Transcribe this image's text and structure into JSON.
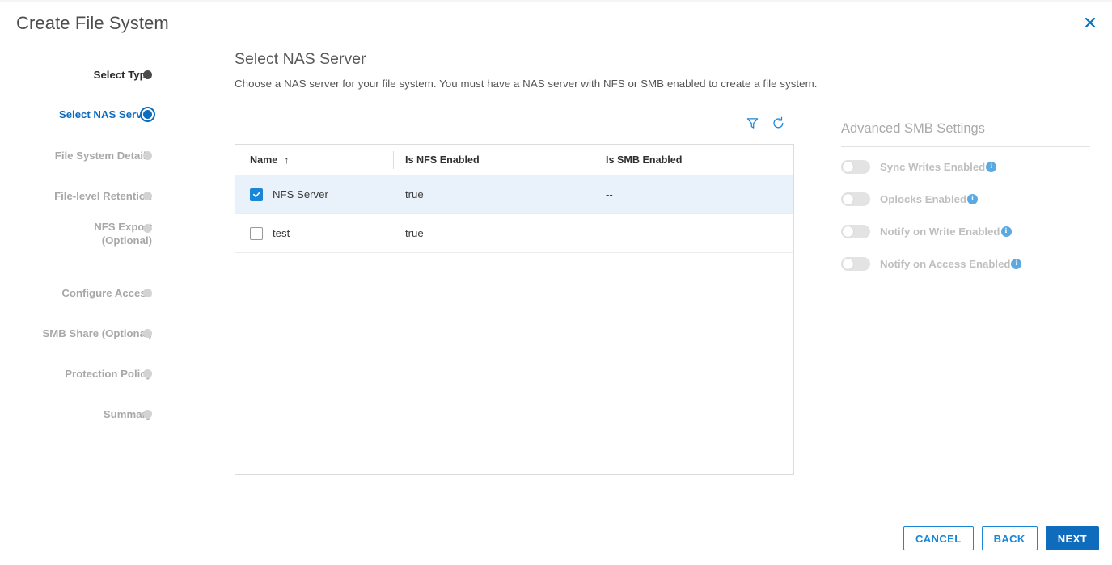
{
  "dialog": {
    "title": "Create File System",
    "close_icon": "close-icon"
  },
  "wizard": {
    "steps": [
      {
        "label": "Select Type",
        "state": "done"
      },
      {
        "label": "Select NAS Server",
        "state": "active"
      },
      {
        "label": "File System Details",
        "state": "pending"
      },
      {
        "label": "File-level Retention",
        "state": "pending"
      },
      {
        "label": "NFS Export\n(Optional)",
        "state": "pending"
      },
      {
        "label": "Configure Access",
        "state": "pending"
      },
      {
        "label": "SMB Share (Optional)",
        "state": "pending"
      },
      {
        "label": "Protection Policy",
        "state": "pending"
      },
      {
        "label": "Summary",
        "state": "pending"
      }
    ]
  },
  "main": {
    "title": "Select NAS Server",
    "subtitle": "Choose a NAS server for your file system. You must have a NAS server with NFS or SMB enabled to create a file system."
  },
  "toolbar": {
    "filter_icon": "filter-icon",
    "refresh_icon": "refresh-icon"
  },
  "table": {
    "columns": [
      {
        "label": "Name",
        "sort": "↑"
      },
      {
        "label": "Is NFS Enabled",
        "sort": ""
      },
      {
        "label": "Is SMB Enabled",
        "sort": ""
      }
    ],
    "rows": [
      {
        "selected": true,
        "name": "NFS Server",
        "is_nfs_enabled": "true",
        "is_smb_enabled": "--"
      },
      {
        "selected": false,
        "name": "test",
        "is_nfs_enabled": "true",
        "is_smb_enabled": "--"
      }
    ]
  },
  "smb_settings": {
    "title": "Advanced SMB Settings",
    "toggles": [
      {
        "label": "Sync Writes Enabled",
        "on": false,
        "info": "i"
      },
      {
        "label": "Oplocks Enabled",
        "on": false,
        "info": "i"
      },
      {
        "label": "Notify on Write Enabled",
        "on": false,
        "info": "i"
      },
      {
        "label": "Notify on Access Enabled",
        "on": false,
        "info": "i"
      }
    ]
  },
  "footer": {
    "cancel_label": "CANCEL",
    "back_label": "BACK",
    "next_label": "NEXT"
  },
  "colors": {
    "accent": "#0f6cbd",
    "link": "#1a86d8",
    "selected_row": "#e9f2fb",
    "disabled_text": "#bfbfbf"
  }
}
